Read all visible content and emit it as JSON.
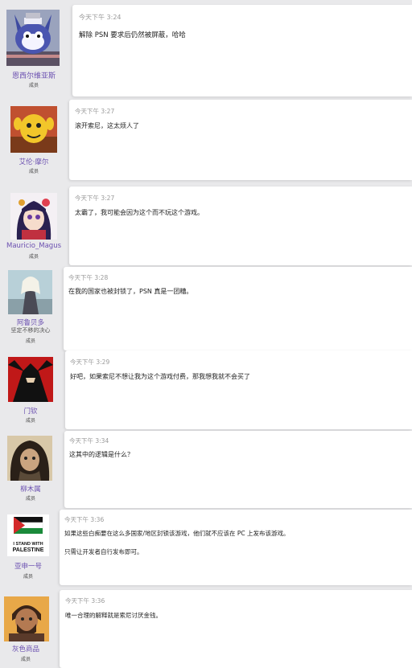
{
  "posts": [
    {
      "author": "恩西尔维亚斯",
      "role": "成员",
      "avatar": "blue-cat-mascot-avatar",
      "time": "今天下午 3:24",
      "lines": [
        "解除 PSN 要求后仍然被屏蔽，哈哈"
      ]
    },
    {
      "author": "艾伦·摩尔",
      "role": "成员",
      "avatar": "yellow-cartoon-character-avatar",
      "time": "今天下午 3:27",
      "lines": [
        "滚开索尼，这太烦人了"
      ]
    },
    {
      "author": "Mauricio_Magus",
      "role": "成员",
      "avatar": "anime-girl-avatar",
      "time": "今天下午 3:27",
      "lines": [
        "太霸了，我可能会因为这个而不玩这个游戏。"
      ]
    },
    {
      "author": "阿鲁贝多",
      "title": "坚定不移的决心",
      "role": "成员",
      "avatar": "white-hair-figure-avatar",
      "time": "今天下午 3:28",
      "lines": [
        "在我的国家也被封锁了，PSN 真是一团糟。"
      ]
    },
    {
      "author": "门钦",
      "role": "成员",
      "avatar": "red-black-samurai-avatar",
      "time": "今天下午 3:29",
      "lines": [
        "好吧，如果索尼不想让我为这个游戏付费，那我想我就不会买了"
      ]
    },
    {
      "author": "柳木属",
      "role": "成员",
      "avatar": "dark-haired-warrior-avatar",
      "time": "今天下午 3:34",
      "lines": [
        "这其中的逻辑是什么？"
      ]
    },
    {
      "author": "亚申一号",
      "role": "成员",
      "avatar": "palestine-flag-avatar",
      "avatar_text": [
        "I STAND WITH",
        "PALESTINE"
      ],
      "time": "今天下午 3:36",
      "lines": [
        "如果这些白痴要在这么多国家/地区封锁该游戏，他们就不应该在 PC 上发布该游戏。",
        "只需让开发者自行发布即可。"
      ]
    },
    {
      "author": "灰色商品",
      "role": "成员",
      "avatar": "bearded-man-avatar",
      "time": "今天下午 3:36",
      "lines": [
        "唯一合理的解释就是索尼讨厌金钱。"
      ]
    }
  ]
}
